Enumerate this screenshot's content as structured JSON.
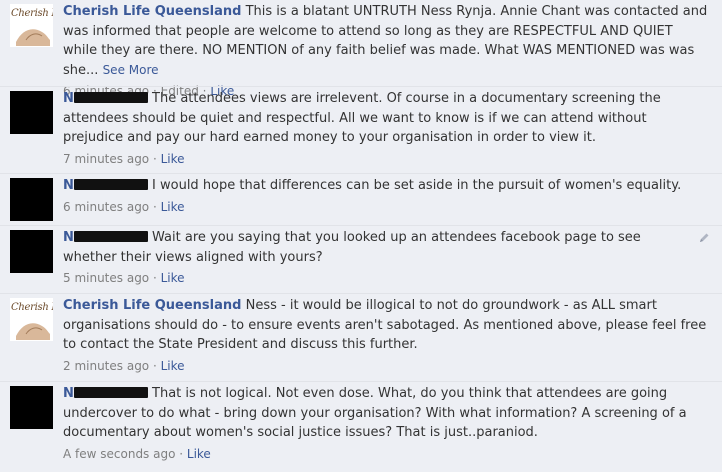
{
  "comments": [
    {
      "author": "Cherish Life Queensland",
      "avatar": "Cherish Life",
      "text": "This is a blatant UNTRUTH Ness Rynja. Annie Chant was contacted and was informed that people are welcome to attend so long as they are RESPECTFUL AND QUIET while they are there. NO MENTION of any faith belief was made. What WAS MENTIONED was was she...",
      "see_more": "See More",
      "time": "6 minutes ago",
      "edited": "Edited",
      "like": "Like"
    },
    {
      "author_initial": "N",
      "text": "The attendees views are irrelevent. Of course in a documentary screening the attendees should be quiet and respectful. All we want to know is if we can attend without prejudice and pay our hard earned money to your organisation in order to view it.",
      "time": "7 minutes ago",
      "like": "Like"
    },
    {
      "author_initial": "N",
      "text": "I would hope that differences can be set aside in the pursuit of women's equality.",
      "time": "6 minutes ago",
      "like": "Like"
    },
    {
      "author_initial": "N",
      "text": "Wait are you saying that you looked up an attendees facebook page to see whether their views aligned with yours?",
      "time": "5 minutes ago",
      "like": "Like"
    },
    {
      "author": "Cherish Life Queensland",
      "avatar": "Cherish Life",
      "text": "Ness - it would be illogical to not do groundwork - as ALL smart organisations should do - to ensure events aren't sabotaged. As mentioned above, please feel free to contact the State President and discuss this further.",
      "time": "2 minutes ago",
      "like": "Like"
    },
    {
      "author_initial": "N",
      "text": "That is not logical. Not even dose. What, do you think that attendees are going undercover to do what - bring down your organisation? With what information? A screening of a documentary about women's social justice issues? That is just..paraniod.",
      "time": "A few seconds ago",
      "like": "Like"
    }
  ],
  "colors": {
    "link": "#3b5998",
    "background": "#edeff4",
    "meta": "#7f7f7f"
  }
}
